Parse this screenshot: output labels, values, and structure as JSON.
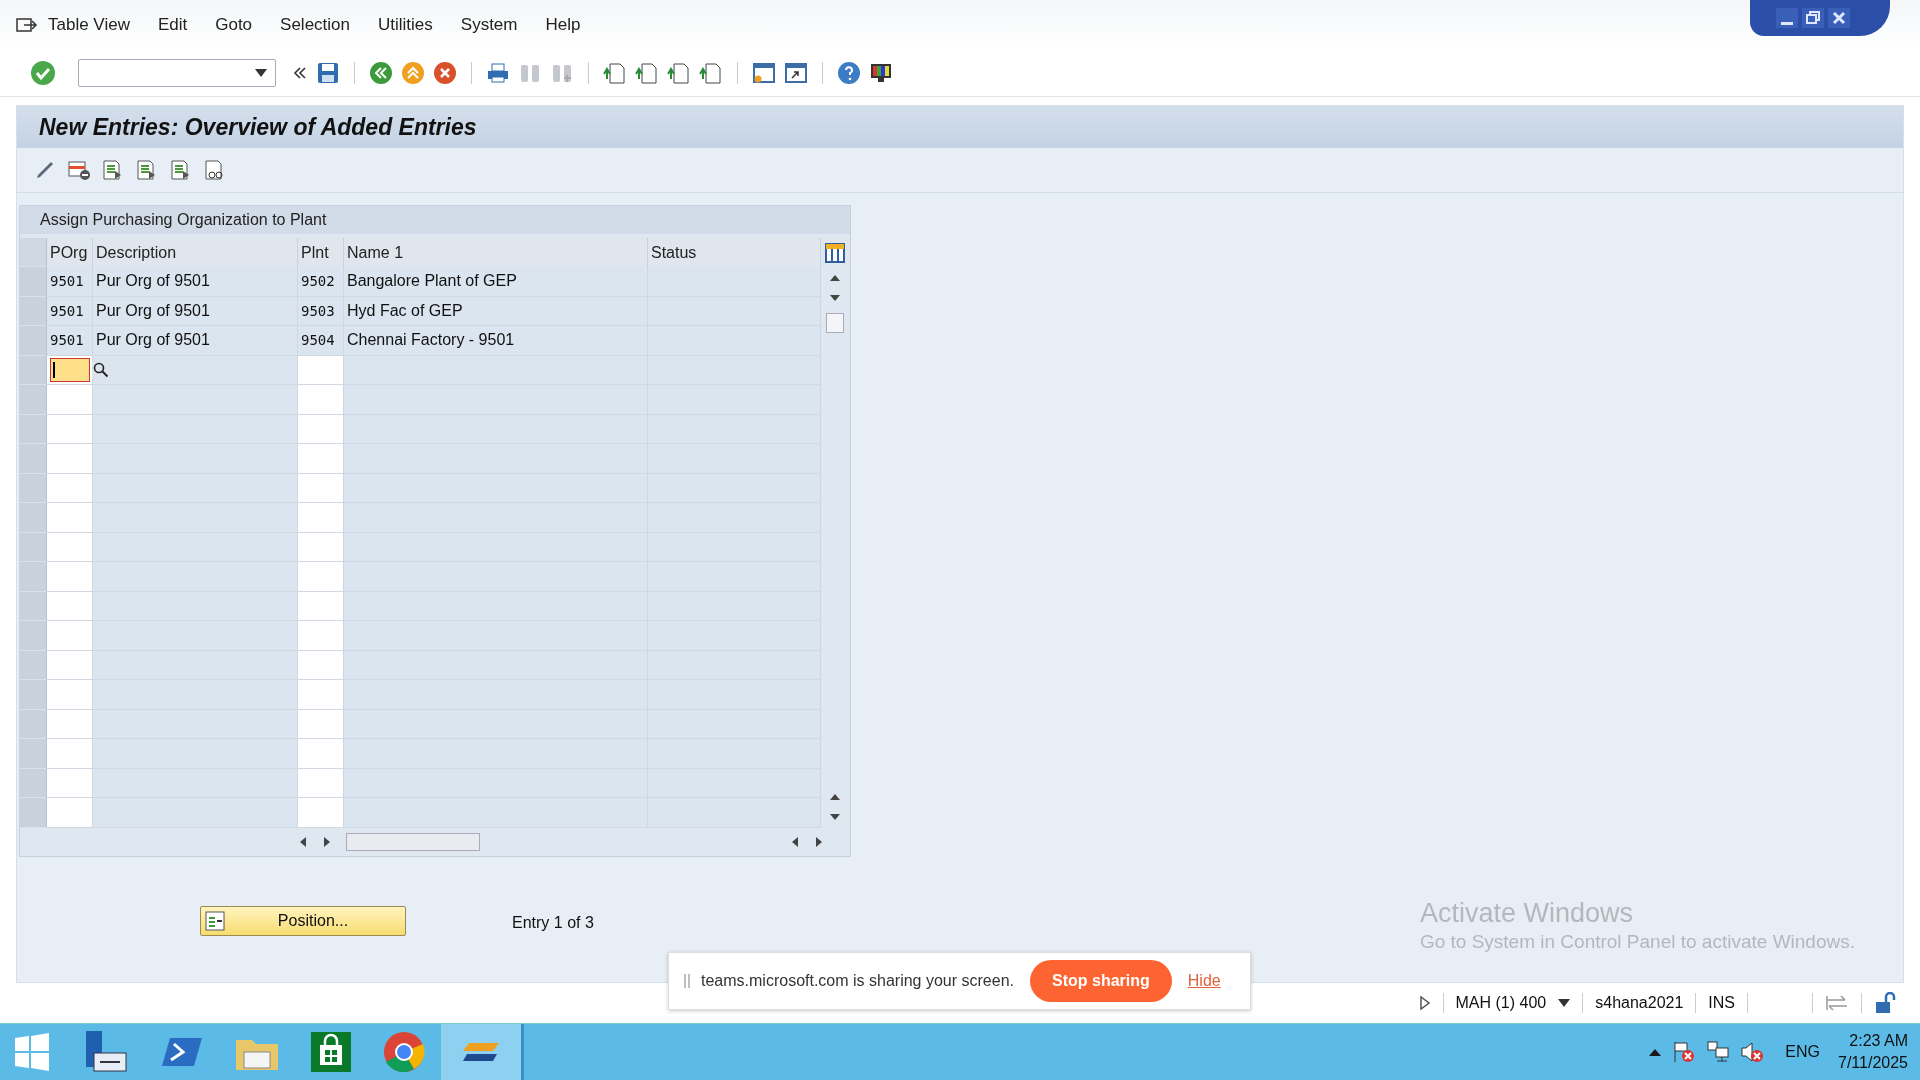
{
  "menu": [
    {
      "label": "Table View"
    },
    {
      "label": "Edit"
    },
    {
      "label": "Goto"
    },
    {
      "label": "Selection"
    },
    {
      "label": "Utilities"
    },
    {
      "label": "System"
    },
    {
      "label": "Help"
    }
  ],
  "title": "New Entries: Overview of Added Entries",
  "table": {
    "title": "Assign Purchasing Organization to Plant",
    "columns": [
      "POrg",
      "Description",
      "Plnt",
      "Name 1",
      "Status"
    ],
    "rows": [
      {
        "porg": "9501",
        "description": "Pur Org of 9501",
        "plant": "9502",
        "name": "Bangalore Plant of GEP"
      },
      {
        "porg": "9501",
        "description": "Pur Org of 9501",
        "plant": "9503",
        "name": "Hyd Fac of GEP"
      },
      {
        "porg": "9501",
        "description": "Pur Org of 9501",
        "plant": "9504",
        "name": "Chennai Factory - 9501"
      }
    ]
  },
  "position_button": "Position...",
  "entry_info": "Entry 1 of 3",
  "activation": {
    "title": "Activate Windows",
    "text": "Go to System in Control Panel to activate Windows."
  },
  "sharing": {
    "message": "teams.microsoft.com is sharing your screen.",
    "stop": "Stop sharing",
    "hide": "Hide"
  },
  "status_bar": {
    "session": "MAH (1) 400",
    "server": "s4hana2021",
    "mode": "INS"
  },
  "taskbar": {
    "language": "ENG",
    "time": "2:23 AM",
    "date": "7/11/2025"
  }
}
